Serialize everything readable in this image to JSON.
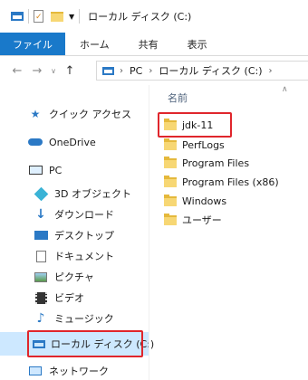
{
  "window": {
    "title": "ローカル ディスク (C:)"
  },
  "ribbon": {
    "tabs": [
      "ファイル",
      "ホーム",
      "共有",
      "表示"
    ]
  },
  "address": {
    "crumbs": [
      "PC",
      "ローカル ディスク (C:)"
    ]
  },
  "nav": {
    "quick_access": "クイック アクセス",
    "onedrive": "OneDrive",
    "pc": "PC",
    "objects3d": "3D オブジェクト",
    "downloads": "ダウンロード",
    "desktop": "デスクトップ",
    "documents": "ドキュメント",
    "pictures": "ピクチャ",
    "videos": "ビデオ",
    "music": "ミュージック",
    "local_disk": "ローカル ディスク (C:)",
    "network": "ネットワーク"
  },
  "content": {
    "column_name": "名前",
    "files": [
      "jdk-11",
      "PerfLogs",
      "Program Files",
      "Program Files (x86)",
      "Windows",
      "ユーザー"
    ]
  },
  "colors": {
    "accent": "#1979ca",
    "highlight": "#e0262c",
    "selection": "#cde8ff",
    "folder": "#f7d774"
  }
}
